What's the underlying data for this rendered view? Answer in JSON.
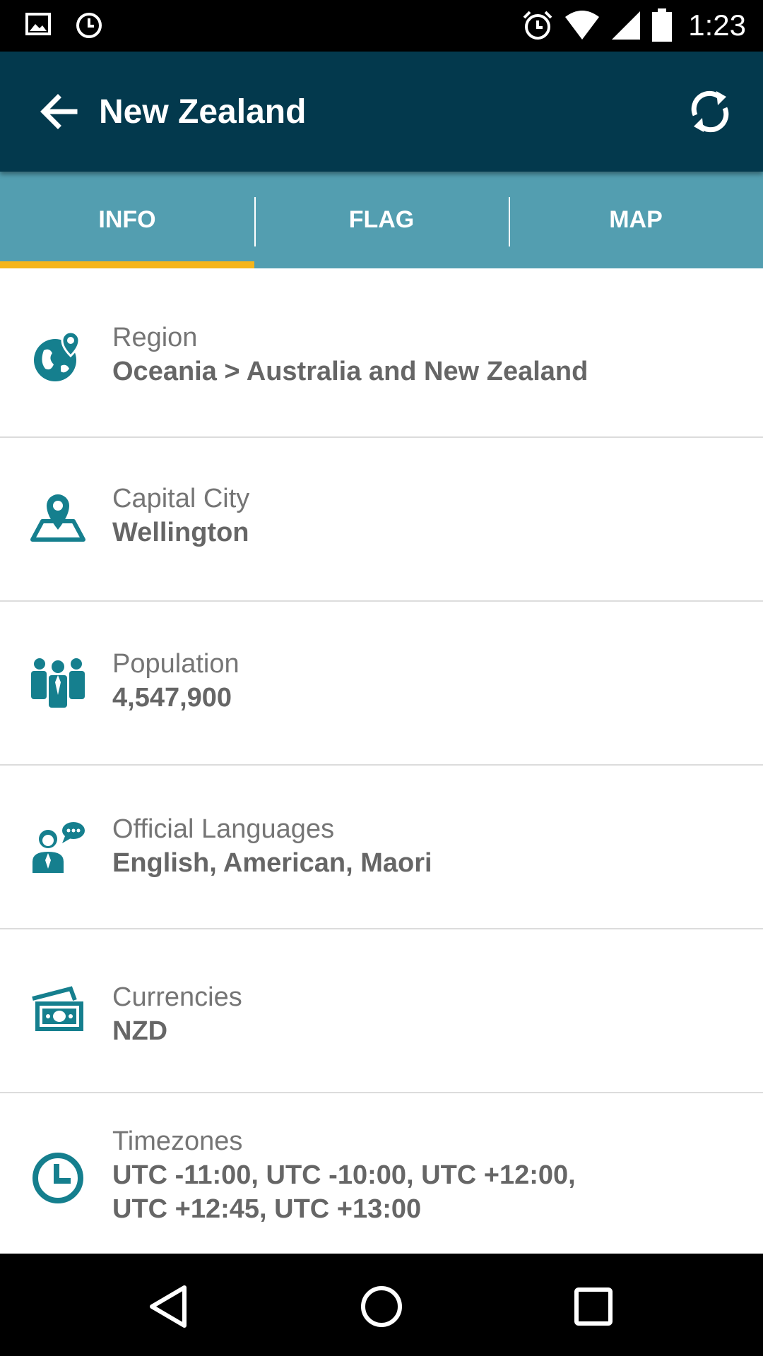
{
  "status_bar": {
    "time": "1:23",
    "icons": [
      "image-icon",
      "clock-icon",
      "alarm-icon",
      "wifi-icon",
      "signal-icon",
      "battery-icon"
    ]
  },
  "app_bar": {
    "title": "New Zealand",
    "back_icon": "arrow-back-icon",
    "refresh_icon": "refresh-icon"
  },
  "tabs": [
    {
      "label": "INFO",
      "selected": true
    },
    {
      "label": "FLAG",
      "selected": false
    },
    {
      "label": "MAP",
      "selected": false
    }
  ],
  "info": {
    "region": {
      "label": "Region",
      "value": "Oceania > Australia and New Zealand",
      "icon": "globe-pin-icon"
    },
    "capital": {
      "label": "Capital City",
      "value": "Wellington",
      "icon": "map-pin-icon"
    },
    "population": {
      "label": "Population",
      "value": "4,547,900",
      "icon": "people-icon"
    },
    "languages": {
      "label": "Official Languages",
      "value": "English, American, Maori",
      "icon": "speech-person-icon"
    },
    "currencies": {
      "label": "Currencies",
      "value": "NZD",
      "icon": "money-icon"
    },
    "timezones": {
      "label": "Timezones",
      "value_line1": "UTC -11:00, UTC -10:00, UTC +12:00,",
      "value_line2": "UTC +12:45, UTC +13:00",
      "icon": "clock-icon"
    }
  },
  "colors": {
    "app_bar": "#03394d",
    "tab_bar": "#539eb0",
    "tab_indicator": "#f5b51b",
    "icon_teal": "#157f8e"
  },
  "nav_bar": {
    "icons": [
      "back-triangle-icon",
      "home-circle-icon",
      "recents-square-icon"
    ]
  }
}
